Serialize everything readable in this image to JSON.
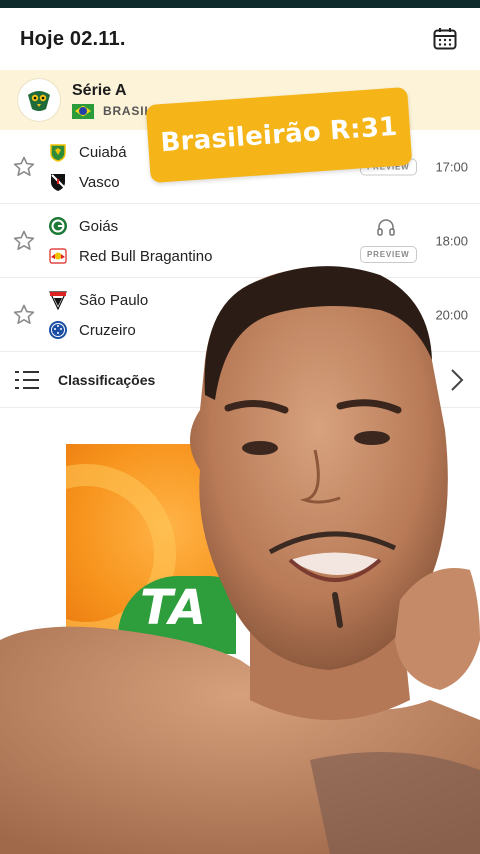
{
  "header": {
    "title": "Hoje 02.11."
  },
  "league": {
    "name": "Série A",
    "country": "BRASIL"
  },
  "matches": [
    {
      "home": "Cuiabá",
      "away": "Vasco",
      "time": "17:00",
      "badge": "PREVIEW"
    },
    {
      "home": "Goiás",
      "away": "Red Bull Bragantino",
      "time": "18:00",
      "badge": "PREVIEW"
    },
    {
      "home": "São Paulo",
      "away": "Cruzeiro",
      "time": "20:00",
      "badge": ""
    }
  ],
  "standings": {
    "label": "Classificações"
  },
  "overlay_caption": "Brasileirão R:31",
  "colors": {
    "league_band": "#fdf3d8",
    "caption_bg": "#f5b417",
    "ad_orange": "#f7941d",
    "ad_green": "#2e9d3b"
  },
  "icons": [
    "calendar-icon",
    "star-icon",
    "headphones-icon",
    "standings-list-icon",
    "chevron-right-icon"
  ]
}
